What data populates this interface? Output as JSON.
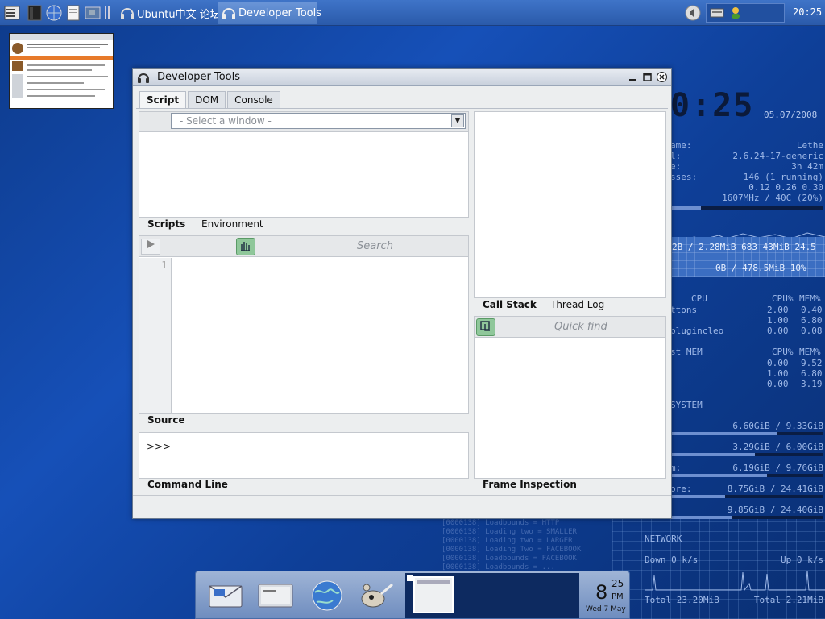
{
  "taskbar": {
    "tasks": [
      {
        "label": "Ubuntu中文 论坛"
      },
      {
        "label": "Developer Tools"
      }
    ],
    "clock": "20:25"
  },
  "window": {
    "title": "Developer Tools",
    "tabs": [
      "Script",
      "DOM",
      "Console"
    ],
    "active_tab": "Script",
    "select_placeholder": "- Select a window -",
    "script_tabs": [
      "Scripts",
      "Environment"
    ],
    "search_placeholder": "Search",
    "line_number": "1",
    "source_label": "Source",
    "console_prompt": ">>>",
    "command_line_label": "Command Line",
    "right_tabs": [
      "Call Stack",
      "Thread Log"
    ],
    "quick_find_placeholder": "Quick find",
    "frame_inspection_label": "Frame Inspection"
  },
  "sysmon": {
    "time_big": "0:25",
    "date": "05.07/2008",
    "rows": [
      {
        "label": "ame:",
        "value": "Lethe"
      },
      {
        "label": "l:",
        "value": "2.6.24-17-generic"
      },
      {
        "label": "e:",
        "value": "3h 42m"
      },
      {
        "label": "sses:",
        "value": "146 (1 running)"
      },
      {
        "label": "",
        "value": "0.12 0.26 0.30"
      },
      {
        "label": "",
        "value": "1607MHz / 40C  (20%)"
      }
    ],
    "grid_text_1": "2B / 2.28MiB   683 43MiB  24.5",
    "grid_text_2": "0B / 478.5MiB   10%",
    "cpu_header": [
      "CPU",
      "CPU%",
      "MEM%"
    ],
    "cpu_rows": [
      {
        "name": "ttons",
        "cpu": "2.00",
        "mem": "0.40"
      },
      {
        "name": "",
        "cpu": "1.00",
        "mem": "6.80"
      },
      {
        "name": "plugincleo",
        "cpu": "0.00",
        "mem": "0.08"
      }
    ],
    "mem_header": [
      "st MEM",
      "CPU%",
      "MEM%"
    ],
    "mem_rows": [
      {
        "cpu": "0.00",
        "mem": "9.52"
      },
      {
        "cpu": "1.00",
        "mem": "6.80"
      },
      {
        "cpu": "0.00",
        "mem": "3.19"
      }
    ],
    "system_label": "SYSTEM",
    "disk_rows": [
      {
        "label": "",
        "value": "6.60GiB / 9.33GiB"
      },
      {
        "label": "",
        "value": "3.29GiB / 6.00GiB"
      },
      {
        "label": "m:",
        "value": "6.19GiB / 9.76GiB"
      },
      {
        "label": "ore:",
        "value": "8.75GiB / 24.41GiB"
      },
      {
        "label": "",
        "value": "9.85GiB / 24.40GiB"
      }
    ]
  },
  "netmon": {
    "title": "NETWORK",
    "down": "Down 0 k/s",
    "up": "Up 0 k/s",
    "total_down": "Total 23.20MiB",
    "total_up": "Total 2.21MiB"
  },
  "bootlog": [
    "[0000138] Loadbounds = HTTP",
    "[0000138] Loading two = SMALLER",
    "[0000138] Loading two = LARGER",
    "[0000138] Loading Two = FACEBOOK",
    "[0000138] Loadbounds = FACEBOOK",
    "[0000138] Loadbounds = ..."
  ],
  "dock": {
    "clock_hour": "8",
    "clock_minute": "25",
    "clock_ampm": "PM",
    "clock_date": "Wed 7 May"
  }
}
